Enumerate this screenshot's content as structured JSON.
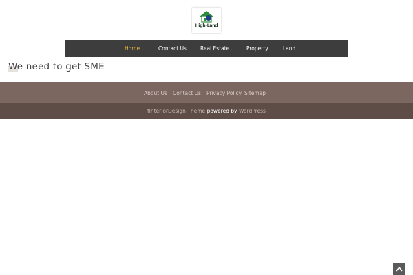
{
  "logo": {
    "text": "High-Land"
  },
  "nav": {
    "items": [
      {
        "label": "Home",
        "has_dropdown": true,
        "active": true
      },
      {
        "label": "Contact Us",
        "has_dropdown": false
      },
      {
        "label": "Real Estate",
        "has_dropdown": true
      },
      {
        "label": "Property",
        "has_dropdown": false
      },
      {
        "label": "Land",
        "has_dropdown": false
      }
    ],
    "caret": "⌄"
  },
  "main": {
    "heading": "We need to get SME"
  },
  "footer": {
    "links": [
      "About Us",
      "Contact Us",
      "Privacy Policy",
      "Sitemap"
    ],
    "credit": {
      "theme": "fInteriorDesign Theme",
      "powered": "powered by",
      "platform": "WordPress"
    }
  },
  "colors": {
    "nav_bg": "#3d3d3d",
    "nav_active": "#e8b53c",
    "footer_top": "#7b6660",
    "footer_bottom": "#5e4d47"
  },
  "icons": {
    "scroll_top": "chevron-up-icon"
  }
}
